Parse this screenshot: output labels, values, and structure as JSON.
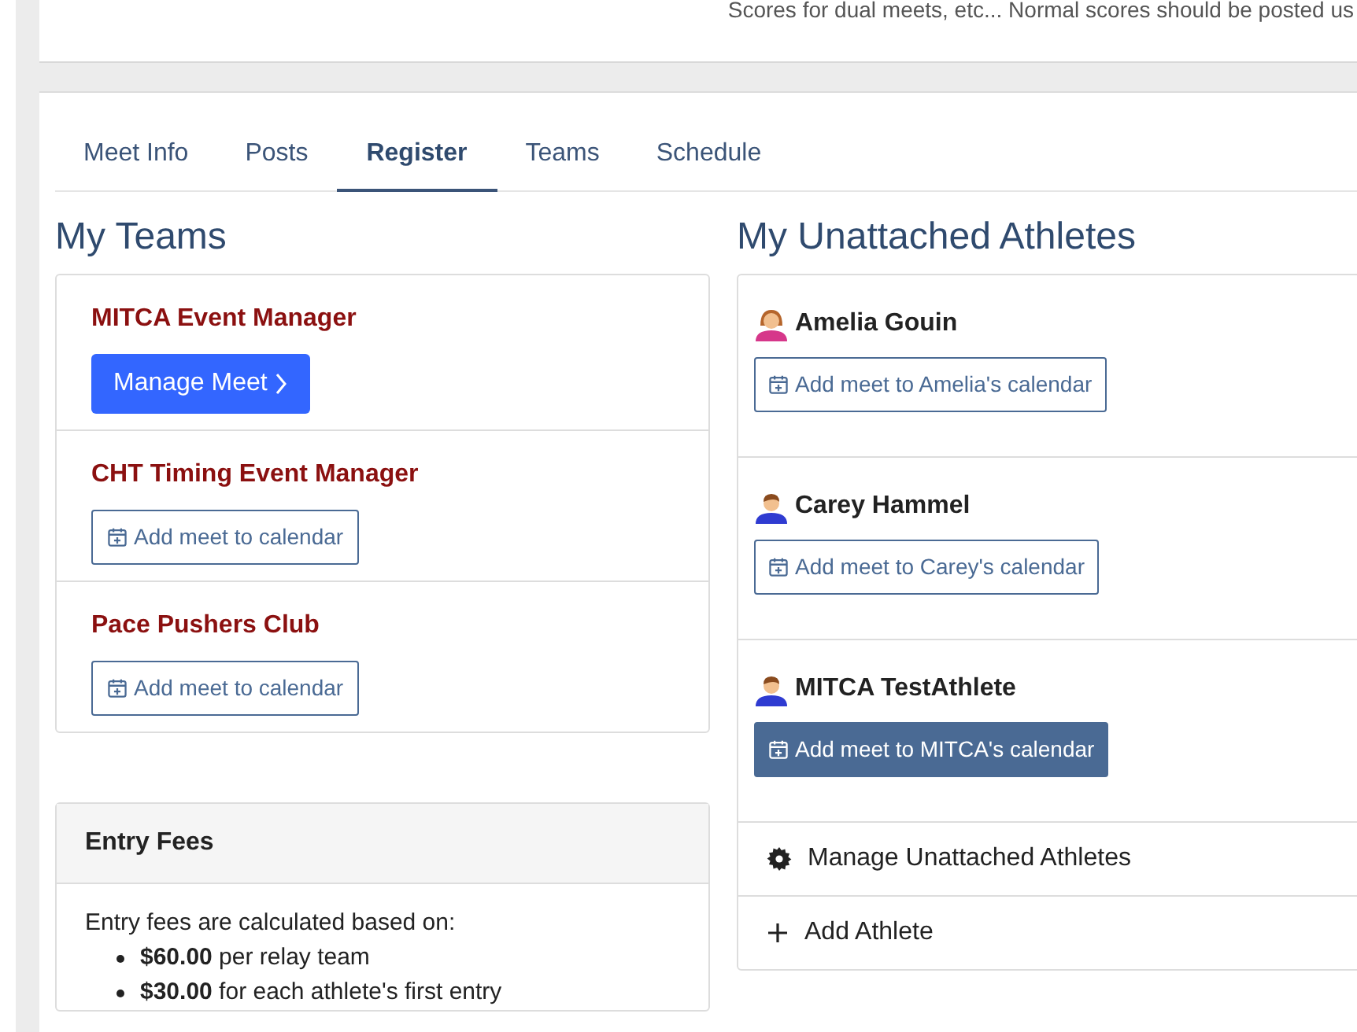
{
  "top_note": "Scores for dual meets, etc... Normal scores should be posted us",
  "tabs": [
    {
      "label": "Meet Info",
      "selected": false
    },
    {
      "label": "Posts",
      "selected": false
    },
    {
      "label": "Register",
      "selected": true
    },
    {
      "label": "Teams",
      "selected": false
    },
    {
      "label": "Schedule",
      "selected": false
    }
  ],
  "my_teams": {
    "heading": "My Teams",
    "teams": [
      {
        "name": "MITCA Event Manager",
        "button": {
          "kind": "manage",
          "label": "Manage Meet"
        }
      },
      {
        "name": "CHT Timing Event Manager",
        "button": {
          "kind": "calendar",
          "label": "Add meet to calendar"
        }
      },
      {
        "name": "Pace Pushers Club",
        "button": {
          "kind": "calendar",
          "label": "Add meet to calendar"
        }
      }
    ]
  },
  "entry_fees": {
    "title": "Entry Fees",
    "intro": "Entry fees are calculated based on:",
    "items": [
      "**$60.00** per relay team",
      "**$30.00** for each athlete's first entry"
    ]
  },
  "unattached": {
    "heading": "My Unattached Athletes",
    "athletes": [
      {
        "name": "Amelia Gouin",
        "kind": "female",
        "button": "Add meet to Amelia's calendar",
        "highlighted": false
      },
      {
        "name": "Carey Hammel",
        "kind": "male",
        "button": "Add meet to Carey's calendar",
        "highlighted": false
      },
      {
        "name": "MITCA TestAthlete",
        "kind": "male",
        "button": "Add meet to MITCA's calendar",
        "highlighted": true
      }
    ],
    "actions": [
      {
        "kind": "manage",
        "label": "Manage Unattached Athletes"
      },
      {
        "kind": "add",
        "label": "Add Athlete"
      }
    ]
  }
}
